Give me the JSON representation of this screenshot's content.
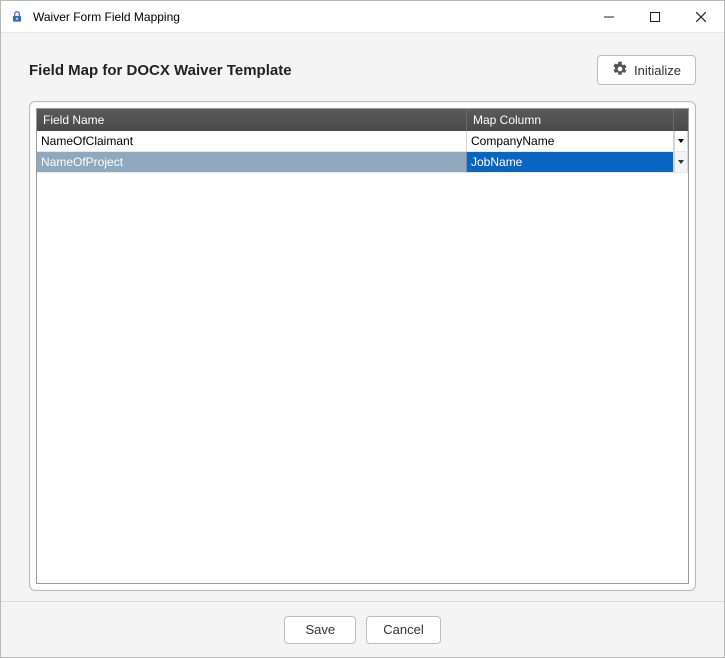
{
  "window": {
    "title": "Waiver Form Field Mapping"
  },
  "header": {
    "heading": "Field Map for DOCX Waiver Template",
    "initialize_label": "Initialize"
  },
  "grid": {
    "columns": {
      "field_name": "Field Name",
      "map_column": "Map Column"
    },
    "rows": [
      {
        "field_name": "NameOfClaimant",
        "map_column": "CompanyName",
        "selected": false
      },
      {
        "field_name": "NameOfProject",
        "map_column": "JobName",
        "selected": true
      }
    ]
  },
  "footer": {
    "save_label": "Save",
    "cancel_label": "Cancel"
  }
}
